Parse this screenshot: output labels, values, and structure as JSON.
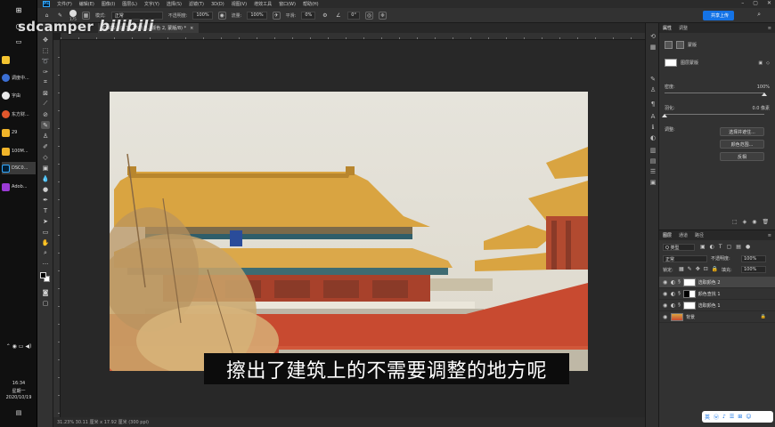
{
  "taskbar": {
    "items": [
      {
        "label": "",
        "color": "#f4c430"
      },
      {
        "label": "调度中...",
        "color": "#3b6fd4"
      },
      {
        "label": "字由",
        "color": "#e8e8e8"
      },
      {
        "label": "东方财...",
        "color": "#e2572c"
      },
      {
        "label": "29",
        "color": "#f0b429"
      },
      {
        "label": "100M...",
        "color": "#f0b429"
      },
      {
        "label": "DSC0...",
        "color": "#31a8ff"
      },
      {
        "label": "Adob...",
        "color": "#9b3bd6"
      }
    ],
    "time": "16:34",
    "weekday": "星期一",
    "date": "2020/10/19"
  },
  "menubar": {
    "items": [
      "文件(F)",
      "编辑(E)",
      "图像(I)",
      "图层(L)",
      "文字(Y)",
      "选择(S)",
      "滤镜(T)",
      "3D(D)",
      "视图(V)",
      "增效工具",
      "窗口(W)",
      "帮助(H)"
    ]
  },
  "options": {
    "brush_size": "175",
    "mode_label": "模式:",
    "mode_value": "正常",
    "opacity_label": "不透明度:",
    "opacity_value": "100%",
    "flow_label": "流量:",
    "flow_value": "100%",
    "smooth_label": "平滑:",
    "smooth_value": "0%",
    "angle_value": "0°",
    "share_label": "共享上传"
  },
  "tab": {
    "title": "DSC0...@ 31.2% (选...颜色 2, 蒙版/8) *",
    "close": "×"
  },
  "watermark": {
    "text": "sdcamper",
    "brand": "bilibili"
  },
  "subtitle": "擦出了建筑上的不需要调整的地方呢",
  "status": {
    "text": "31.23%   30.11 厘米 x 17.92 厘米 (300 ppi)"
  },
  "properties": {
    "tabs": [
      "属性",
      "调整"
    ],
    "section_label": "蒙版",
    "layer_mask_label": "图层蒙版",
    "density_label": "密度:",
    "density_value": "100%",
    "feather_label": "羽化:",
    "feather_value": "0.0 像素",
    "density": 1.0,
    "feather": 0.0,
    "adjust_label": "调整:",
    "buttons": [
      "选择并遮住...",
      "颜色范围...",
      "反相"
    ]
  },
  "layers": {
    "tabs": [
      "图层",
      "通道",
      "路径"
    ],
    "kind_label": "Q 类型",
    "blend_mode": "正常",
    "opacity_label": "不透明度:",
    "opacity_value": "100%",
    "lock_label": "锁定:",
    "fill_label": "填充:",
    "fill_value": "100%",
    "items": [
      {
        "name": "选取颜色 2",
        "selected": true
      },
      {
        "name": "颜色查找 1",
        "selected": false
      },
      {
        "name": "选取颜色 1",
        "selected": false
      },
      {
        "name": "背景",
        "selected": false
      }
    ]
  },
  "ime": {
    "glyphs": [
      "英",
      "ⓦ",
      "♪",
      "☰",
      "⊞",
      "☺"
    ]
  },
  "colors": {
    "accent": "#1473e6",
    "ps_blue": "#31a8ff",
    "wall_red": "#c84a30",
    "roof_gold": "#d9a441"
  }
}
